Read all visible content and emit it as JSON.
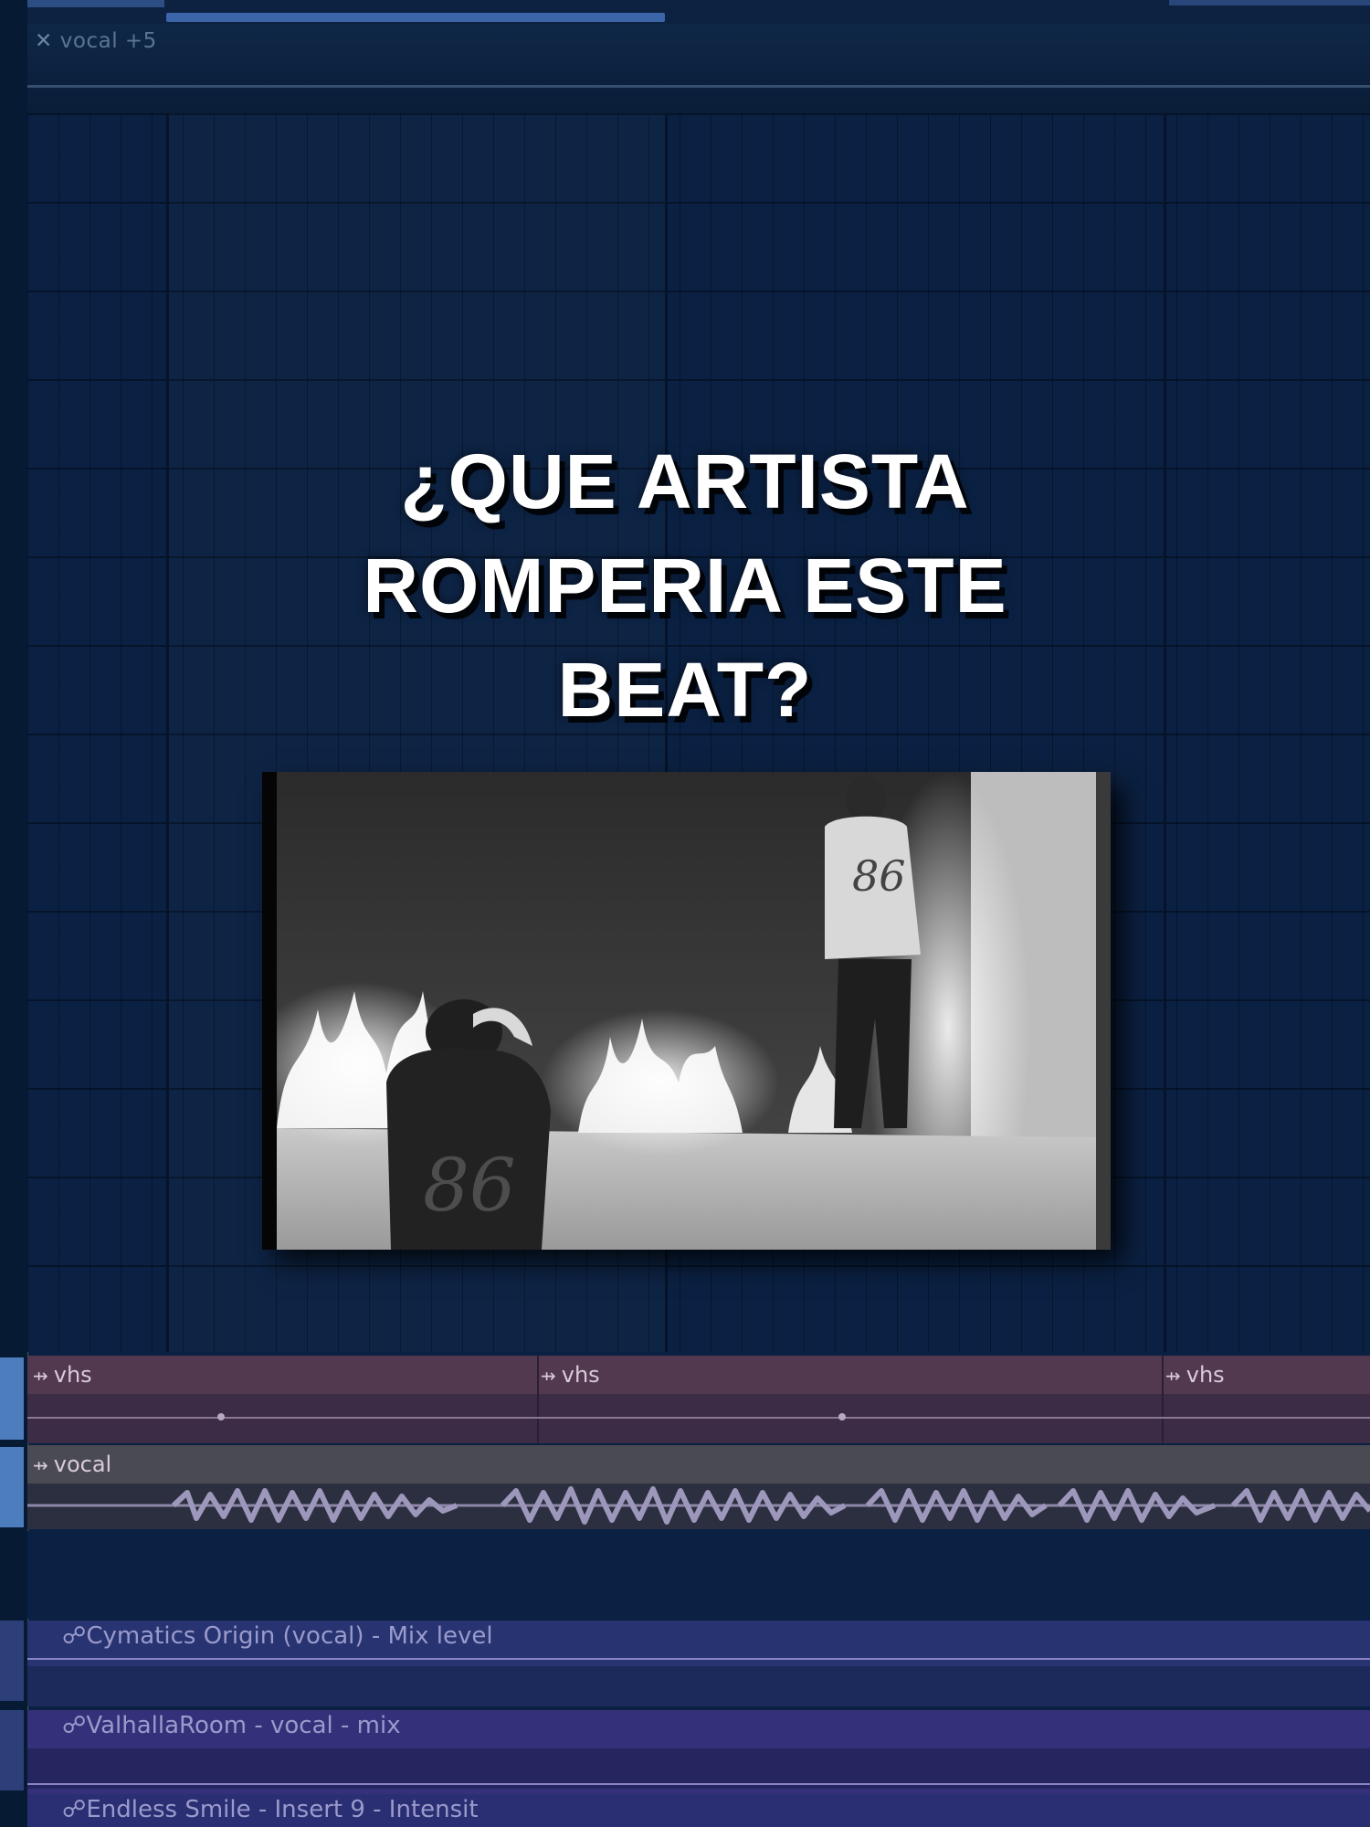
{
  "automation_clip": {
    "icon": "close-icon",
    "label": "vocal +5"
  },
  "overlay": {
    "line1": "¿QUE ARTISTA",
    "line2": "ROMPERIA ESTE",
    "line3": "BEAT?"
  },
  "video": {
    "description_icon": "video-thumbnail"
  },
  "tracks": {
    "vhs": {
      "clips": [
        {
          "label": "vhs"
        },
        {
          "label": "vhs"
        },
        {
          "label": "vhs"
        }
      ],
      "color": "#52394f"
    },
    "vocal": {
      "label": "vocal",
      "color": "#4a4a52"
    }
  },
  "automation": [
    {
      "label": "Cymatics Origin (vocal) - Mix level"
    },
    {
      "label": "ValhallaRoom - vocal - mix"
    },
    {
      "label": "Endless Smile - Insert 9 - Intensit"
    }
  ],
  "colors": {
    "background": "#0b2143",
    "selection": "#4d7dbd",
    "automation_clip": "#3d3d84"
  }
}
